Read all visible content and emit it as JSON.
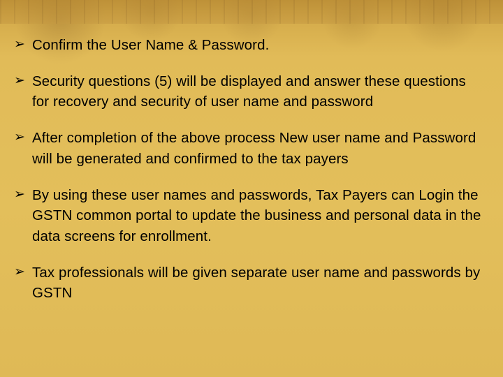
{
  "bullets": [
    "Confirm the User Name & Password.",
    "Security  questions (5) will be displayed and answer these questions for recovery  and security of user name and password",
    "After completion of the above process New user name and Password will be generated and confirmed to  the tax payers",
    "By using these user names and passwords, Tax Payers can Login the GSTN common portal to update the business and personal data in the data screens for enrollment.",
    "Tax professionals will be given  separate user name and passwords by  GSTN"
  ]
}
